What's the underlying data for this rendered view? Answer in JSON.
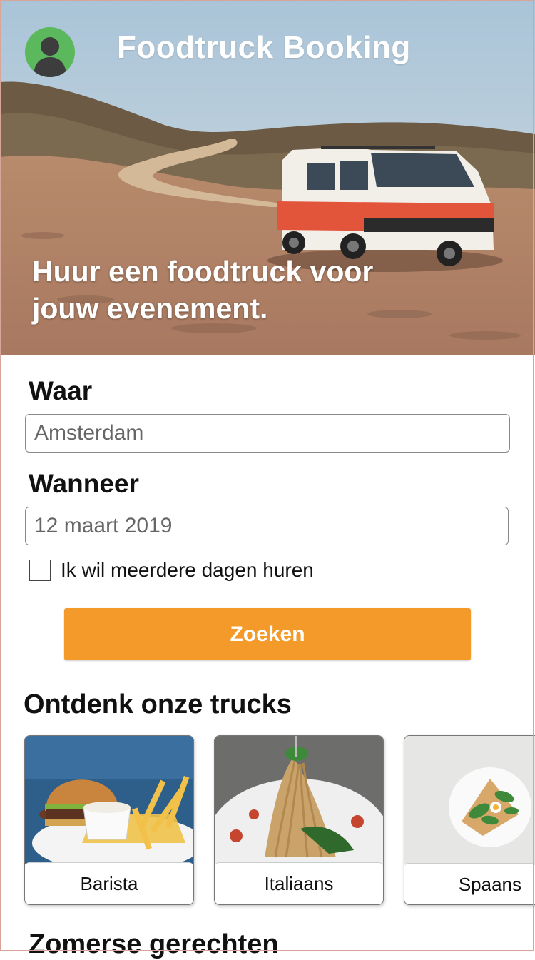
{
  "header": {
    "app_title": "Foodtruck Booking",
    "avatar_icon": "user-avatar-icon",
    "avatar_color": "#5cb85c"
  },
  "hero": {
    "tagline_line1": "Huur een foodtruck voor",
    "tagline_line2": "jouw evenement."
  },
  "form": {
    "where_label": "Waar",
    "where_value": "Amsterdam",
    "when_label": "Wanneer",
    "when_value": "12 maart 2019",
    "multi_day_label": "Ik wil meerdere dagen huren",
    "multi_day_checked": false,
    "search_button": "Zoeken",
    "accent_color": "#f39a2b"
  },
  "trucks": {
    "title": "Ontdenk onze trucks",
    "items": [
      {
        "label": "Barista"
      },
      {
        "label": "Italiaans"
      },
      {
        "label": "Spaans"
      }
    ]
  },
  "summer": {
    "title": "Zomerse gerechten"
  }
}
